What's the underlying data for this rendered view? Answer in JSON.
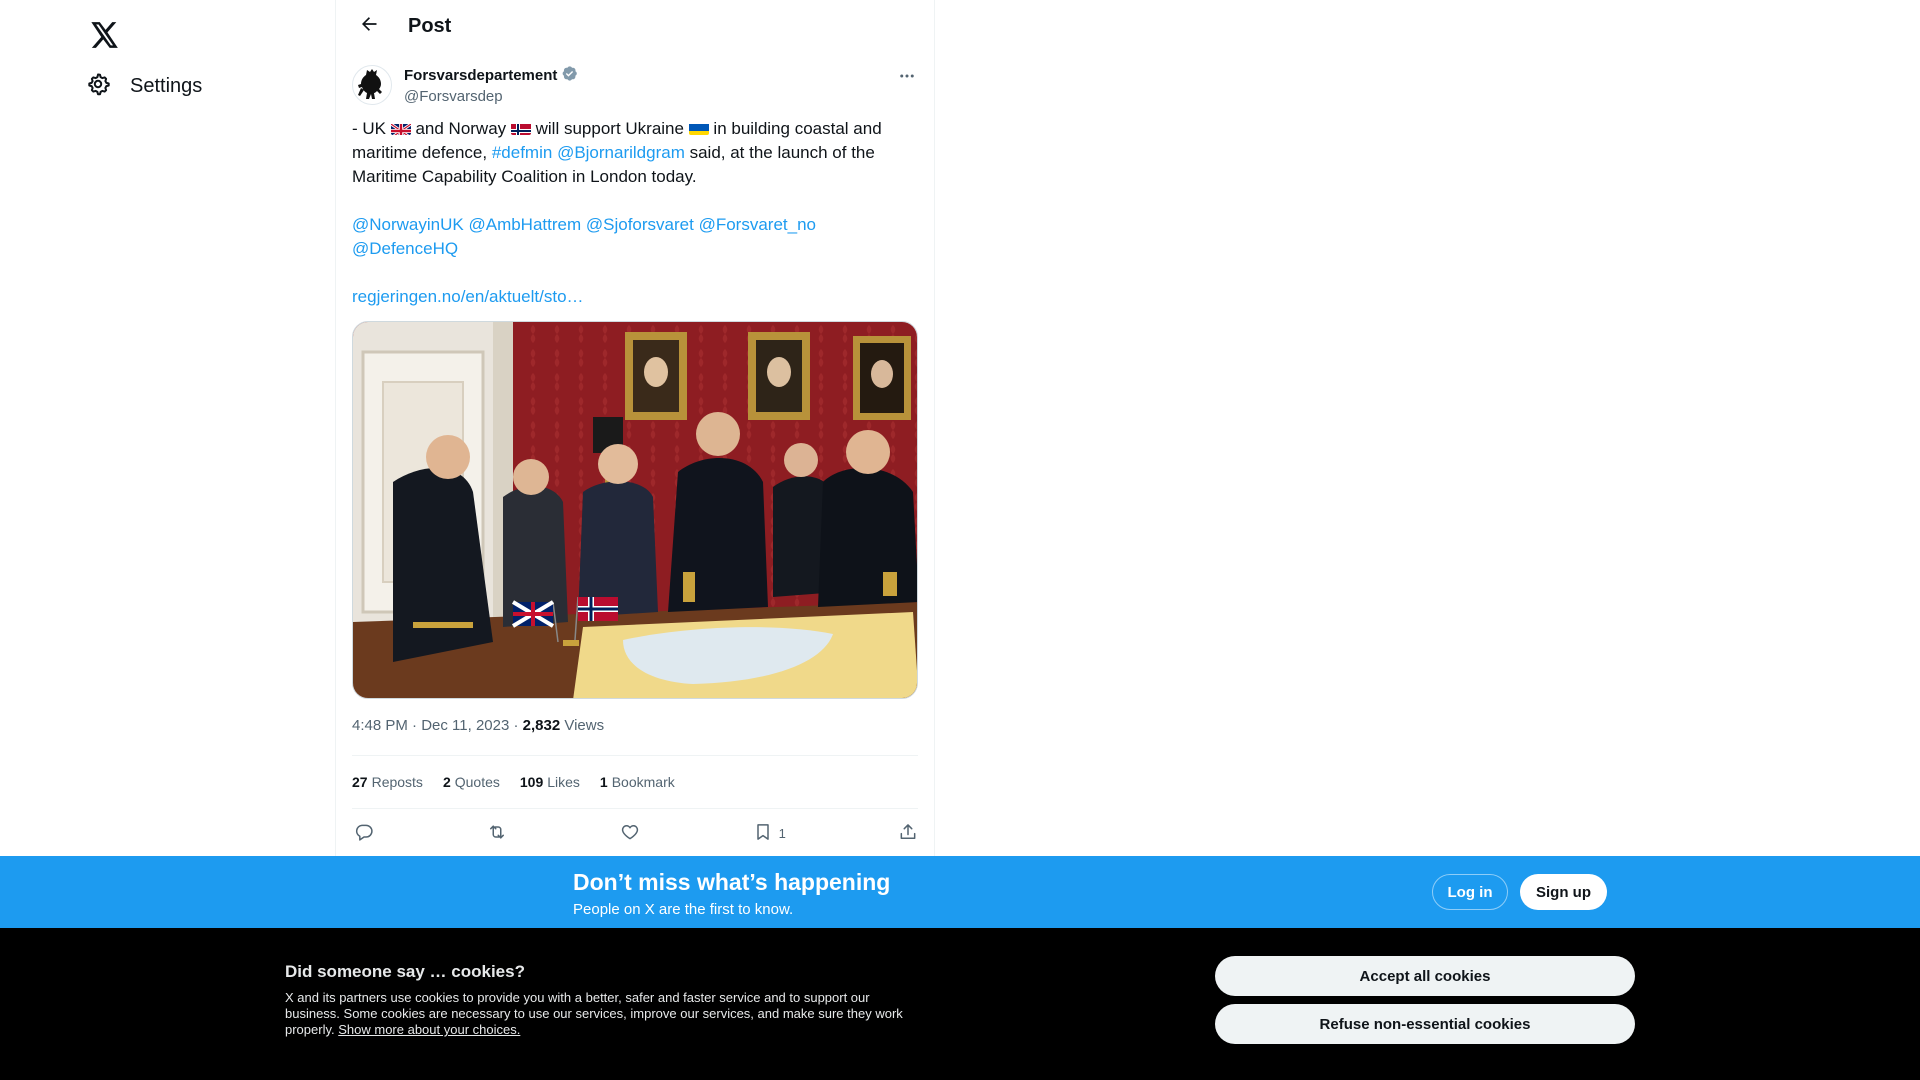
{
  "nav": {
    "logo_icon": "x-logo-icon",
    "settings_label": "Settings",
    "settings_icon": "gear-icon"
  },
  "header": {
    "title": "Post",
    "back_icon": "arrow-left-icon"
  },
  "tweet": {
    "author": {
      "display_name": "Forsvarsdepartement",
      "handle": "@Forsvarsdep",
      "verified_icon": "verified-badge-icon",
      "avatar_icon": "norwegian-lion-crest-icon"
    },
    "text": {
      "l1_a": "- UK ",
      "l1_b": " and Norway ",
      "l1_c": " will support Ukraine ",
      "l1_d": " in building coastal and maritime defence, ",
      "hashtag": "#defmin",
      "mention_1": "@Bjornarildgram",
      "l2": " said, at the launch of the Maritime Capability Coalition in London today.",
      "mentions": [
        "@NorwayinUK",
        "@AmbHattrem",
        "@Sjoforsvaret",
        "@Forsvaret_no",
        "@DefenceHQ"
      ],
      "url": "regjeringen.no/en/aktuelt/sto…",
      "flags": [
        "uk-flag-icon",
        "norway-flag-icon",
        "ukraine-flag-icon"
      ]
    },
    "timestamp": "4:48 PM · Dec 11, 2023",
    "separator": " · ",
    "views_count": "2,832",
    "views_label": " Views",
    "stats": [
      {
        "num": "27",
        "label": "Reposts"
      },
      {
        "num": "2",
        "label": "Quotes"
      },
      {
        "num": "109",
        "label": "Likes"
      },
      {
        "num": "1",
        "label": "Bookmark"
      }
    ],
    "actions": {
      "reply_icon": "reply-icon",
      "repost_icon": "repost-icon",
      "like_icon": "heart-icon",
      "bookmark_icon": "bookmark-icon",
      "bookmark_count": "1",
      "share_icon": "share-icon"
    }
  },
  "banner": {
    "title": "Don’t miss what’s happening",
    "subtitle": "People on X are the first to know.",
    "login": "Log in",
    "signup": "Sign up"
  },
  "cookies": {
    "title": "Did someone say … cookies?",
    "body": "X and its partners use cookies to provide you with a better, safer and faster service and to support our business. Some cookies are necessary to use our services, improve our services, and make sure they work properly. ",
    "more_link": "Show more about your choices.",
    "accept": "Accept all cookies",
    "refuse": "Refuse non-essential cookies"
  },
  "colors": {
    "accent": "#1d9bf0",
    "text": "#0f1419",
    "muted": "#536471",
    "cookie_bg": "#000000"
  }
}
